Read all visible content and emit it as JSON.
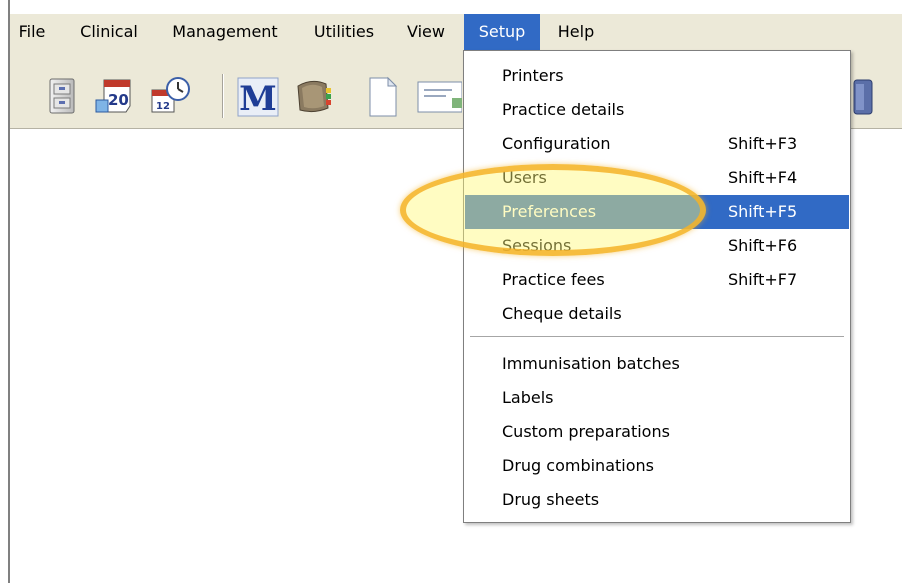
{
  "menubar": {
    "items": [
      {
        "label": "File"
      },
      {
        "label": "Clinical"
      },
      {
        "label": "Management"
      },
      {
        "label": "Utilities"
      },
      {
        "label": "View"
      },
      {
        "label": "Setup",
        "active": true
      },
      {
        "label": "Help"
      }
    ]
  },
  "toolbar": {
    "icons": [
      "filing-cabinet-icon",
      "calendar-20-icon",
      "calendar-clock-icon",
      "m-logo-icon",
      "address-book-icon",
      "blank-document-icon",
      "card-document-icon",
      "device-icon"
    ],
    "calendar_day": "20",
    "calendar_small_day": "12",
    "logo_letter": "M"
  },
  "setup_menu": {
    "group1": [
      {
        "label": "Printers",
        "shortcut": ""
      },
      {
        "label": "Practice details",
        "shortcut": ""
      },
      {
        "label": "Configuration",
        "shortcut": "Shift+F3"
      },
      {
        "label": "Users",
        "shortcut": "Shift+F4"
      },
      {
        "label": "Preferences",
        "shortcut": "Shift+F5",
        "highlighted": true
      },
      {
        "label": "Sessions",
        "shortcut": "Shift+F6"
      },
      {
        "label": "Practice fees",
        "shortcut": "Shift+F7"
      },
      {
        "label": "Cheque details",
        "shortcut": ""
      }
    ],
    "group2": [
      {
        "label": "Immunisation batches"
      },
      {
        "label": "Labels"
      },
      {
        "label": "Custom preparations"
      },
      {
        "label": "Drug combinations"
      },
      {
        "label": "Drug sheets"
      }
    ]
  },
  "colors": {
    "menu_bg": "#ece9d8",
    "selection": "#316ac5",
    "halo": "#f4b228",
    "halo_fill": "#fff878"
  }
}
